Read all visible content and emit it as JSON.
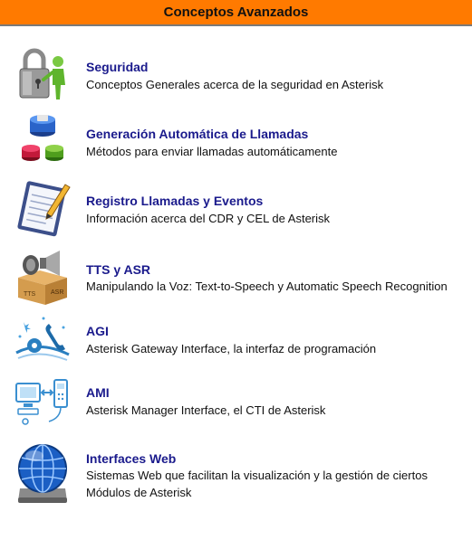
{
  "header": {
    "title": "Conceptos Avanzados",
    "background_color": "#ff7a00"
  },
  "items": [
    {
      "title": "Seguridad",
      "description": "Conceptos Generales acerca de la seguridad en Asterisk",
      "icon": "padlock-person-icon"
    },
    {
      "title": "Generación Automática de Llamadas",
      "description": "Métodos para enviar llamadas automáticamente",
      "icon": "colored-buttons-icon"
    },
    {
      "title": "Registro Llamadas y Eventos",
      "description": "Información acerca del CDR y CEL de Asterisk",
      "icon": "notepad-pencil-icon"
    },
    {
      "title": "TTS y ASR",
      "description": "Manipulando la Voz: Text-to-Speech y Automatic Speech Recognition",
      "icon": "speakers-box-icon"
    },
    {
      "title": "AGI",
      "description": "Asterisk Gateway Interface, la interfaz de programación",
      "icon": "phone-icon"
    },
    {
      "title": "AMI",
      "description": "Asterisk Manager Interface, el CTI de Asterisk",
      "icon": "computer-phone-icon"
    },
    {
      "title": "Interfaces Web",
      "description": "Sistemas Web que facilitan la visualización y la gestión de ciertos Módulos de Asterisk",
      "icon": "globe-drive-icon"
    }
  ],
  "colors": {
    "link": "#1a1a8c",
    "text": "#111111"
  }
}
